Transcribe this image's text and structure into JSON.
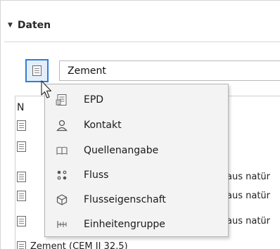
{
  "section": {
    "title": "Daten",
    "toggle_icon": "triangle-down-icon"
  },
  "type_button": {
    "icon": "document-icon"
  },
  "search": {
    "value": "Zement"
  },
  "results": {
    "header": "N",
    "rows": [
      {
        "label": "",
        "tail": ""
      },
      {
        "label": "",
        "tail": ""
      },
      {
        "label": "",
        "tail": "aus natür"
      },
      {
        "label": "",
        "tail": "aus natür"
      },
      {
        "label": "",
        "tail": "aus natür"
      },
      {
        "label": "Zement (CEM II 32,5)",
        "tail": ""
      }
    ]
  },
  "dropdown": {
    "items": [
      {
        "label": "EPD",
        "icon": "epd-document-icon"
      },
      {
        "label": "Kontakt",
        "icon": "person-icon"
      },
      {
        "label": "Quellenangabe",
        "icon": "book-icon"
      },
      {
        "label": "Fluss",
        "icon": "flow-icon"
      },
      {
        "label": "Flusseigenschaft",
        "icon": "cube-icon"
      },
      {
        "label": "Einheitengruppe",
        "icon": "ruler-icon"
      }
    ]
  }
}
